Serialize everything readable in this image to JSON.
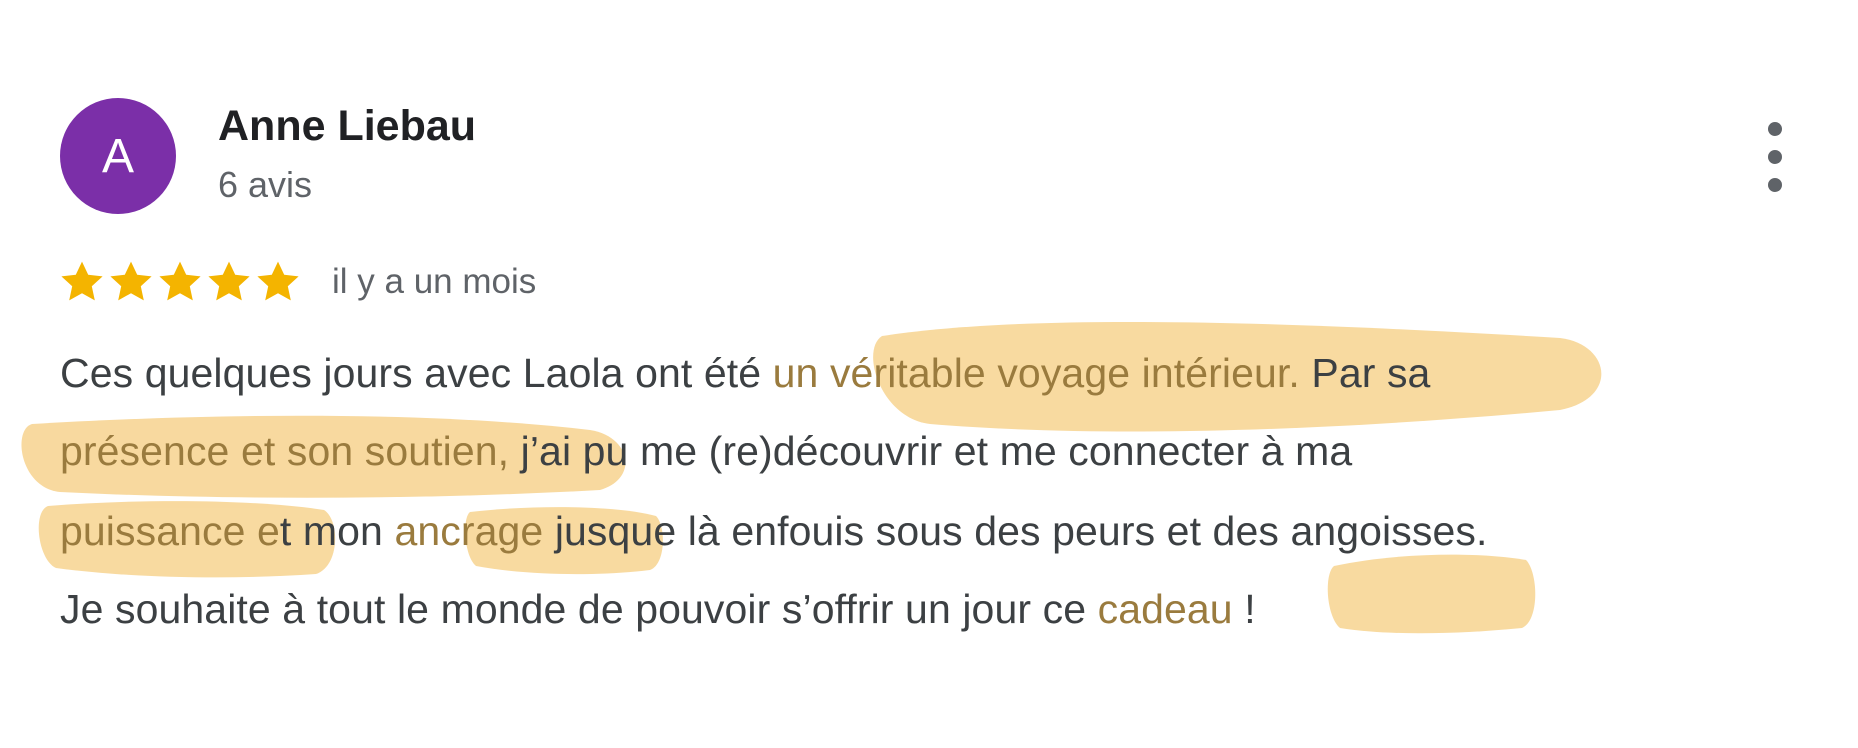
{
  "review": {
    "author": "Anne Liebau",
    "avatar_letter": "A",
    "review_count": "6 avis",
    "rating": 5,
    "rating_max": 5,
    "date": "il y a un mois",
    "menu_icon": "more-vertical-icon",
    "star_icon": "star-icon",
    "text_lines": [
      [
        {
          "text": "Ces quelques jours avec Laola ont été ",
          "hl": false
        },
        {
          "text": "un véritable voyage intérieur.",
          "hl": true
        },
        {
          "text": " Par sa",
          "hl": false
        }
      ],
      [
        {
          "text": "présence et son soutien,",
          "hl": true
        },
        {
          "text": " j’ai pu me (re)découvrir et me connecter à ma",
          "hl": false
        }
      ],
      [
        {
          "text": "puissance e",
          "hl": true
        },
        {
          "text": "t mon ",
          "hl": false
        },
        {
          "text": "ancrage",
          "hl": true
        },
        {
          "text": " jusque là enfouis sous des peurs et des angoisses.",
          "hl": false
        }
      ],
      [
        {
          "text": "Je souhaite à tout le monde de pouvoir s’offrir un jour ce ",
          "hl": false
        },
        {
          "text": "cadeau",
          "hl": true
        },
        {
          "text": " !",
          "hl": false
        }
      ]
    ]
  },
  "colors": {
    "avatar_bg": "#7b2fa8",
    "star": "#f4b400",
    "highlight": "#f7d38f",
    "highlight_text": "#9a7b3e",
    "body_text": "#3c4043",
    "secondary_text": "#5f6368"
  }
}
